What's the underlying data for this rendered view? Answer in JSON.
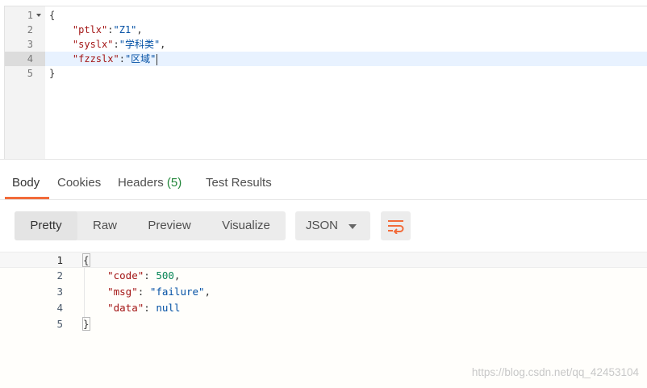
{
  "request_editor": {
    "lines": [
      {
        "number": "1",
        "foldable": true,
        "tokens": [
          {
            "t": "{",
            "c": "jpunc"
          }
        ]
      },
      {
        "number": "2",
        "tokens": [
          {
            "t": "    ",
            "c": "jpunc"
          },
          {
            "t": "\"ptlx\"",
            "c": "jkey"
          },
          {
            "t": ":",
            "c": "jpunc"
          },
          {
            "t": "\"Z1\"",
            "c": "jstr"
          },
          {
            "t": ",",
            "c": "jpunc"
          }
        ]
      },
      {
        "number": "3",
        "tokens": [
          {
            "t": "    ",
            "c": "jpunc"
          },
          {
            "t": "\"syslx\"",
            "c": "jkey"
          },
          {
            "t": ":",
            "c": "jpunc"
          },
          {
            "t": "\"学科类\"",
            "c": "jstr"
          },
          {
            "t": ",",
            "c": "jpunc"
          }
        ]
      },
      {
        "number": "4",
        "active": true,
        "tokens": [
          {
            "t": "    ",
            "c": "jpunc"
          },
          {
            "t": "\"fzzslx\"",
            "c": "jkey"
          },
          {
            "t": ":",
            "c": "jpunc"
          },
          {
            "t": "\"区域\"",
            "c": "jstr"
          }
        ]
      },
      {
        "number": "5",
        "tokens": [
          {
            "t": "}",
            "c": "jpunc"
          }
        ]
      }
    ]
  },
  "response_tabs": {
    "body": "Body",
    "cookies": "Cookies",
    "headers": "Headers",
    "headers_count": "(5)",
    "test_results": "Test Results"
  },
  "view_toolbar": {
    "pretty": "Pretty",
    "raw": "Raw",
    "preview": "Preview",
    "visualize": "Visualize",
    "format": "JSON",
    "wrap_icon": "wrap-lines-icon"
  },
  "response_body": {
    "lines": [
      {
        "number": "1",
        "tokens": [
          {
            "t": "{",
            "c": "bracket"
          }
        ]
      },
      {
        "number": "2",
        "tokens": [
          {
            "t": "    ",
            "c": ""
          },
          {
            "t": "\"code\"",
            "c": "rkey"
          },
          {
            "t": ": ",
            "c": ""
          },
          {
            "t": "500",
            "c": "rnum"
          },
          {
            "t": ",",
            "c": ""
          }
        ]
      },
      {
        "number": "3",
        "tokens": [
          {
            "t": "    ",
            "c": ""
          },
          {
            "t": "\"msg\"",
            "c": "rkey"
          },
          {
            "t": ": ",
            "c": ""
          },
          {
            "t": "\"failure\"",
            "c": "rstr"
          },
          {
            "t": ",",
            "c": ""
          }
        ]
      },
      {
        "number": "4",
        "tokens": [
          {
            "t": "    ",
            "c": ""
          },
          {
            "t": "\"data\"",
            "c": "rkey"
          },
          {
            "t": ": ",
            "c": ""
          },
          {
            "t": "null",
            "c": "rnull"
          }
        ]
      },
      {
        "number": "5",
        "tokens": [
          {
            "t": "}",
            "c": "bracket"
          }
        ]
      }
    ]
  },
  "watermark": "https://blog.csdn.net/qq_42453104",
  "colors": {
    "accent": "#f26b3a",
    "headers_count": "#22863a",
    "active_line": "#e8f2ff"
  }
}
